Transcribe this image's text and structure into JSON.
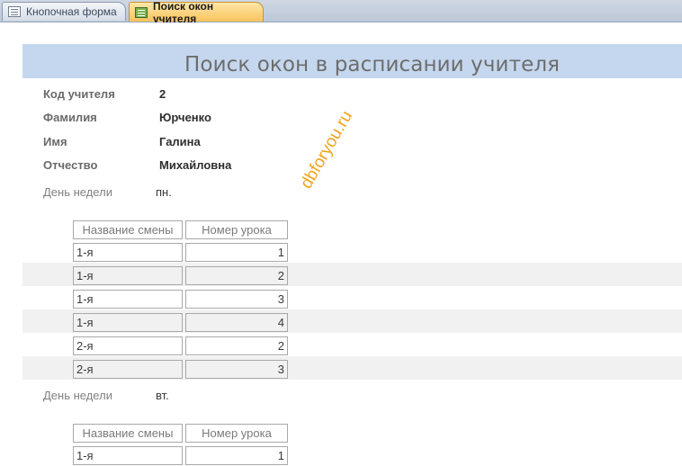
{
  "tabs": [
    {
      "label": "Кнопочная форма",
      "icon": "switchboard-form-icon",
      "active": false
    },
    {
      "label": "Поиск окон учителя",
      "icon": "form-icon",
      "active": true
    }
  ],
  "form": {
    "title": "Поиск окон в расписании учителя",
    "fields": {
      "teacher_code": {
        "label": "Код учителя",
        "value": "2"
      },
      "last_name": {
        "label": "Фамилия",
        "value": "Юрченко"
      },
      "first_name": {
        "label": "Имя",
        "value": "Галина"
      },
      "patronymic": {
        "label": "Отчество",
        "value": "Михайловна"
      }
    },
    "days": [
      {
        "label": "День недели",
        "value": "пн.",
        "columns": [
          "Название смены",
          "Номер урока"
        ],
        "rows": [
          [
            "1-я",
            "1"
          ],
          [
            "1-я",
            "2"
          ],
          [
            "1-я",
            "3"
          ],
          [
            "1-я",
            "4"
          ],
          [
            "2-я",
            "2"
          ],
          [
            "2-я",
            "3"
          ]
        ]
      },
      {
        "label": "День недели",
        "value": "вт.",
        "columns": [
          "Название смены",
          "Номер урока"
        ],
        "rows": [
          [
            "1-я",
            "1"
          ]
        ]
      }
    ]
  },
  "watermark": "dbforyou.ru",
  "colors": {
    "header_band": "#c5d7ee",
    "active_tab": "#f8c25c",
    "watermark": "#f0a41e"
  }
}
